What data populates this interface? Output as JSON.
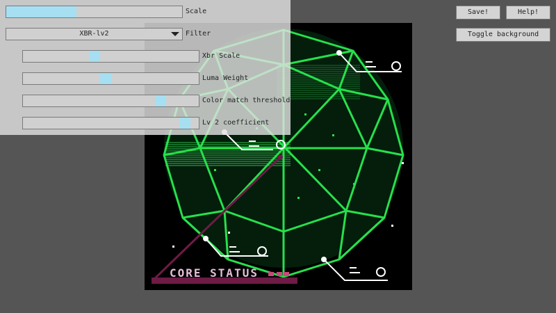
{
  "settings": {
    "scale": {
      "label": "Scale",
      "value": 0.4
    },
    "filter": {
      "label": "Filter",
      "selected": "XBR-lv2"
    },
    "xbr_scale": {
      "label": "Xbr Scale",
      "value": 0.4
    },
    "luma_weight": {
      "label": "Luma Weight",
      "value": 0.47
    },
    "color_match_threshold": {
      "label": "Color match threshold",
      "value": 0.8
    },
    "lv2_coefficient": {
      "label": "Lv 2 coefficient",
      "value": 0.95
    }
  },
  "buttons": {
    "save": "Save!",
    "help": "Help!",
    "toggle_background": "Toggle background"
  },
  "artwork": {
    "caption": "CORE STATUS",
    "colors": {
      "wireframe": "#27e04c",
      "glow": "#b9f7c4",
      "accent": "#6e1b45",
      "caption": "#e6bfd9"
    }
  }
}
